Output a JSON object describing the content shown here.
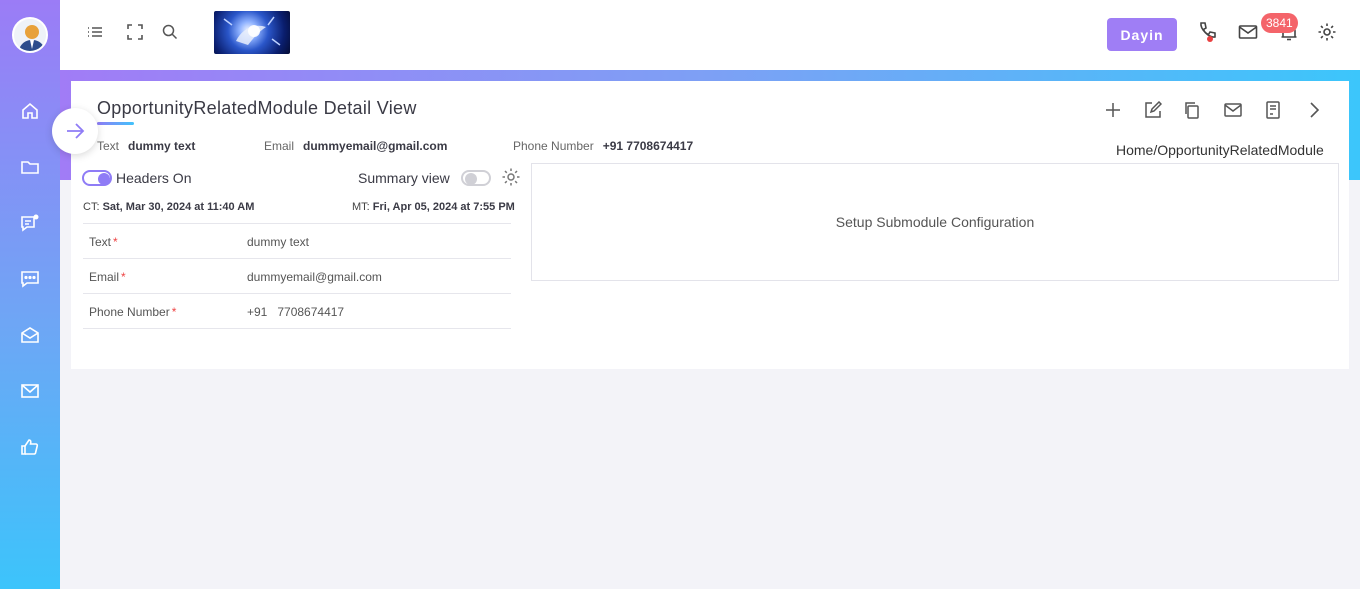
{
  "header": {
    "user_button": "Dayin",
    "notification_count": "3841"
  },
  "page": {
    "title": "OpportunityRelatedModule Detail View",
    "breadcrumb": "Home/OpportunityRelatedModule"
  },
  "summary": [
    {
      "label": "Text",
      "value": "dummy text"
    },
    {
      "label": "Email",
      "value": "dummyemail@gmail.com"
    },
    {
      "label": "Phone Number",
      "value": "+91 7708674417"
    }
  ],
  "controls": {
    "headers_toggle_label": "Headers On",
    "summary_view_label": "Summary view",
    "created_label": "CT:",
    "created_value": "Sat, Mar 30, 2024 at 11:40 AM",
    "modified_label": "MT:",
    "modified_value": "Fri, Apr 05, 2024 at 7:55 PM"
  },
  "fields": [
    {
      "label": "Text",
      "required_mark": "*",
      "value": "dummy text"
    },
    {
      "label": "Email",
      "required_mark": "*",
      "value": "dummyemail@gmail.com"
    },
    {
      "label": "Phone Number",
      "required_mark": "*",
      "value": "+91   7708674417"
    }
  ],
  "submodule": {
    "message": "Setup Submodule Configuration"
  },
  "icons": {
    "sidebar": [
      "home-icon",
      "folder-icon",
      "chat-icon",
      "message-icon",
      "envelope-open-icon",
      "mail-icon",
      "thumbs-up-icon"
    ],
    "topbar": [
      "menu-icon",
      "fullscreen-icon",
      "search-icon",
      "phone-icon",
      "mail-icon",
      "bell-icon",
      "gear-icon"
    ],
    "toolbar": [
      "plus-icon",
      "edit-icon",
      "copy-icon",
      "mail-icon",
      "document-icon",
      "chevron-right-icon"
    ]
  },
  "colors": {
    "accent": "#9f7ef5",
    "gradient_start": "#a17cf6",
    "gradient_end": "#3cc6fb",
    "badge": "#f4646a",
    "required": "#ee4444"
  }
}
